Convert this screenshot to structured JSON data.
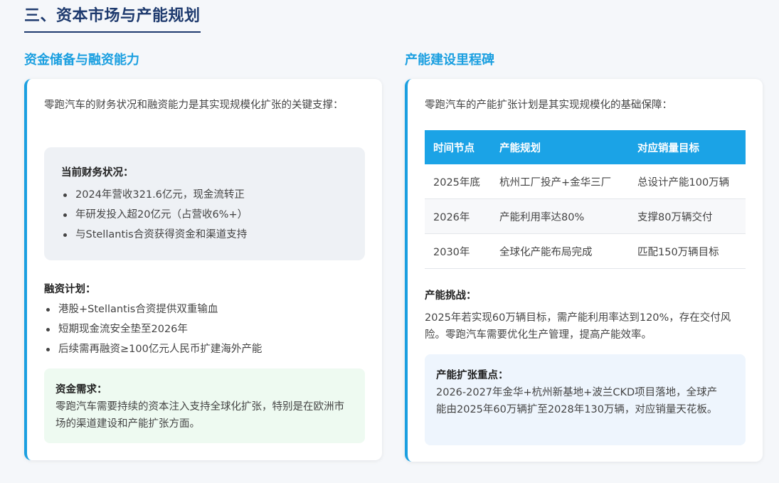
{
  "section": {
    "title": "三、资本市场与产能规划"
  },
  "left": {
    "title": "资金储备与融资能力",
    "intro": "零跑汽车的财务状况和融资能力是其实现规模化扩张的关键支撑：",
    "finance": {
      "heading": "当前财务状况：",
      "items": [
        "2024年营收321.6亿元，现金流转正",
        "年研发投入超20亿元（占营收6%+）",
        "与Stellantis合资获得资金和渠道支持"
      ]
    },
    "plan": {
      "heading": "融资计划：",
      "items": [
        "港股+Stellantis合资提供双重输血",
        "短期现金流安全垫至2026年",
        "后续需再融资≥100亿元人民币扩建海外产能"
      ]
    },
    "need": {
      "heading": "资金需求：",
      "text": "零跑汽车需要持续的资本注入支持全球化扩张，特别是在欧洲市场的渠道建设和产能扩张方面。"
    }
  },
  "right": {
    "title": "产能建设里程碑",
    "intro": "零跑汽车的产能扩张计划是其实现规模化的基础保障：",
    "table": {
      "headers": [
        "时间节点",
        "产能规划",
        "对应销量目标"
      ],
      "rows": [
        [
          "2025年底",
          "杭州工厂投产+金华三厂",
          "总设计产能100万辆"
        ],
        [
          "2026年",
          "产能利用率达80%",
          "支撑80万辆交付"
        ],
        [
          "2030年",
          "全球化产能布局完成",
          "匹配150万辆目标"
        ]
      ]
    },
    "challenge": {
      "heading": "产能挑战：",
      "text": "2025年若实现60万辆目标，需产能利用率达到120%，存在交付风险。零跑汽车需要优化生产管理，提高产能效率。"
    },
    "focus": {
      "heading": "产能扩张重点：",
      "text": "2026-2027年金华+杭州新基地+波兰CKD项目落地，全球产能由2025年60万辆扩至2028年130万辆，对应销量天花板。"
    }
  }
}
